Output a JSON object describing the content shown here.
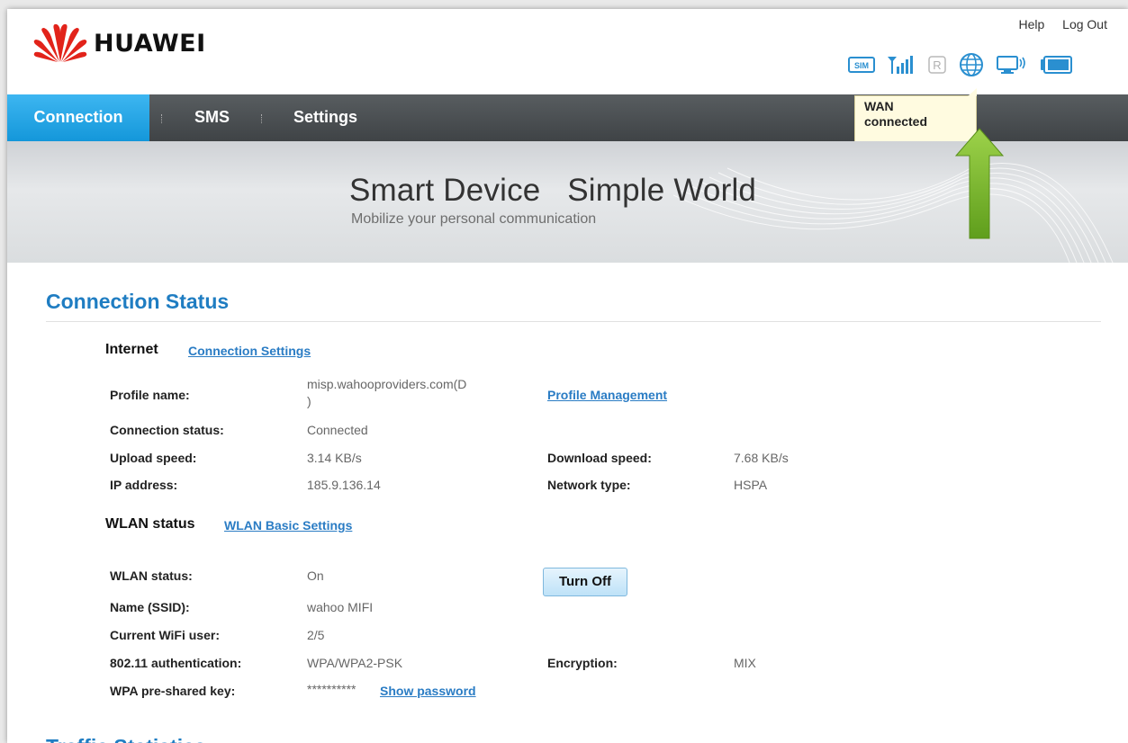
{
  "header": {
    "brand": "HUAWEI",
    "help_label": "Help",
    "logout_label": "Log Out",
    "icons": [
      "sim-icon",
      "signal-icon",
      "roaming-icon",
      "globe-icon",
      "monitor-icon",
      "battery-icon"
    ],
    "sim_label": "SIM",
    "roaming_label": "R"
  },
  "nav": {
    "items": [
      {
        "label": "Connection",
        "active": true
      },
      {
        "label": "SMS",
        "active": false
      },
      {
        "label": "Settings",
        "active": false
      }
    ]
  },
  "tooltip": {
    "line1": "WAN",
    "line2": "connected"
  },
  "banner": {
    "title": "Smart Device   Simple World",
    "subtitle": "Mobilize your personal communication"
  },
  "main": {
    "title": "Connection Status",
    "internet": {
      "heading": "Internet",
      "settings_link": "Connection Settings",
      "profile_name_label": "Profile name:",
      "profile_name_value_line1": "misp.wahooproviders.com(D",
      "profile_name_value_line2": ")",
      "profile_management_link": "Profile Management",
      "connection_status_label": "Connection status:",
      "connection_status_value": "Connected",
      "upload_speed_label": "Upload speed:",
      "upload_speed_value": "3.14 KB/s",
      "download_speed_label": "Download speed:",
      "download_speed_value": "7.68 KB/s",
      "ip_address_label": "IP address:",
      "ip_address_value": "185.9.136.14",
      "network_type_label": "Network type:",
      "network_type_value": "HSPA"
    },
    "wlan": {
      "heading": "WLAN status",
      "settings_link": "WLAN Basic Settings",
      "status_label": "WLAN status:",
      "status_value": "On",
      "turn_off_button": "Turn Off",
      "ssid_label": "Name (SSID):",
      "ssid_value": "wahoo MIFI",
      "wifi_user_label": "Current WiFi user:",
      "wifi_user_value": "2/5",
      "auth_label": "802.11 authentication:",
      "auth_value": "WPA/WPA2-PSK",
      "encryption_label": "Encryption:",
      "encryption_value": "MIX",
      "psk_label": "WPA pre-shared key:",
      "psk_value": "**********",
      "show_password_link": "Show password"
    },
    "next_section_title": "Traffic Statistics"
  },
  "colors": {
    "accent_blue": "#1f7dc2",
    "nav_active": "#1e9fe0",
    "nav_bg": "#4b4f52",
    "logo_red": "#e2231a",
    "icon_blue": "#2a8fd0",
    "arrow_green": "#7fbf2a"
  }
}
